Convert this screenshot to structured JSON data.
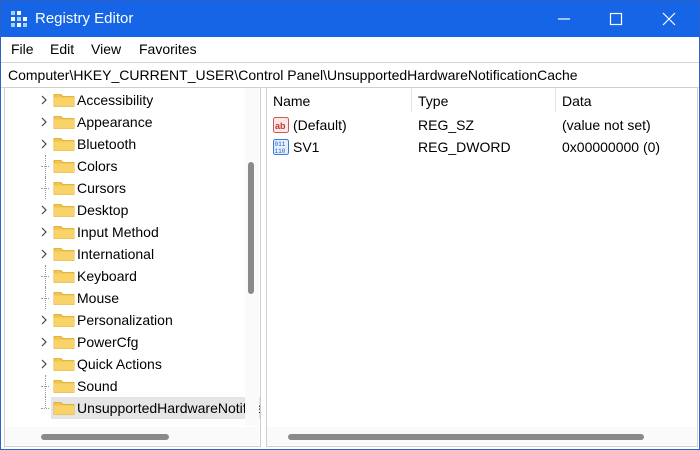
{
  "window": {
    "title": "Registry Editor"
  },
  "menu": [
    "File",
    "Edit",
    "View",
    "Favorites"
  ],
  "address": "Computer\\HKEY_CURRENT_USER\\Control Panel\\UnsupportedHardwareNotificationCache",
  "tree": {
    "items": [
      {
        "label": "Accessibility",
        "expandable": true
      },
      {
        "label": "Appearance",
        "expandable": true
      },
      {
        "label": "Bluetooth",
        "expandable": true
      },
      {
        "label": "Colors",
        "expandable": false
      },
      {
        "label": "Cursors",
        "expandable": false
      },
      {
        "label": "Desktop",
        "expandable": true
      },
      {
        "label": "Input Method",
        "expandable": true
      },
      {
        "label": "International",
        "expandable": true
      },
      {
        "label": "Keyboard",
        "expandable": false
      },
      {
        "label": "Mouse",
        "expandable": false
      },
      {
        "label": "Personalization",
        "expandable": true
      },
      {
        "label": "PowerCfg",
        "expandable": true
      },
      {
        "label": "Quick Actions",
        "expandable": true
      },
      {
        "label": "Sound",
        "expandable": false
      },
      {
        "label": "UnsupportedHardwareNotificationCache",
        "expandable": false,
        "selected": true
      }
    ]
  },
  "list": {
    "columns": [
      "Name",
      "Type",
      "Data"
    ],
    "rows": [
      {
        "name": "(Default)",
        "type": "REG_SZ",
        "data": "(value not set)",
        "icon": "string-value-icon"
      },
      {
        "name": "SV1",
        "type": "REG_DWORD",
        "data": "0x00000000 (0)",
        "icon": "binary-value-icon"
      }
    ]
  },
  "colors": {
    "titlebar": "#1565e6",
    "folder": "#f3c44a",
    "selection": "#e5e5e5"
  }
}
